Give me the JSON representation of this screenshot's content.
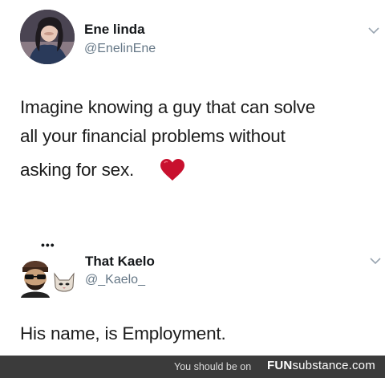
{
  "tweets": [
    {
      "author_name": "Ene linda",
      "author_handle": "@EnelinEne",
      "text_lines": [
        "Imagine knowing a guy that can solve",
        "all your financial problems without",
        "asking for sex."
      ],
      "emoji": "heart-icon"
    },
    {
      "author_name": "That Kaelo",
      "author_handle": "@_Kaelo_",
      "text": "His name, is Employment.",
      "thread_indicator": "•••"
    }
  ],
  "footer": {
    "prefix": "You should be on",
    "brand_bold": "FUN",
    "brand_rest": "substance.com"
  },
  "colors": {
    "heart": "#c8102e",
    "handle": "#657786",
    "footer_bg": "#3b3b3b"
  }
}
